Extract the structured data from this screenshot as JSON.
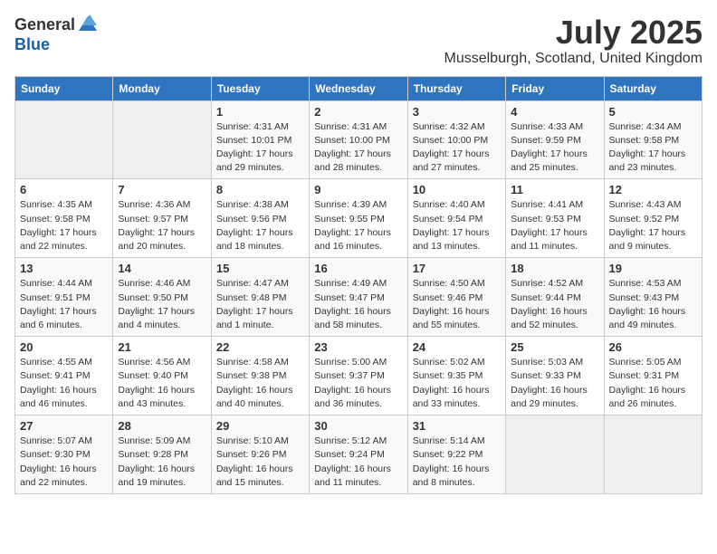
{
  "header": {
    "logo_general": "General",
    "logo_blue": "Blue",
    "month_title": "July 2025",
    "location": "Musselburgh, Scotland, United Kingdom"
  },
  "days_of_week": [
    "Sunday",
    "Monday",
    "Tuesday",
    "Wednesday",
    "Thursday",
    "Friday",
    "Saturday"
  ],
  "weeks": [
    [
      {
        "day": "",
        "info": ""
      },
      {
        "day": "",
        "info": ""
      },
      {
        "day": "1",
        "info": "Sunrise: 4:31 AM\nSunset: 10:01 PM\nDaylight: 17 hours and 29 minutes."
      },
      {
        "day": "2",
        "info": "Sunrise: 4:31 AM\nSunset: 10:00 PM\nDaylight: 17 hours and 28 minutes."
      },
      {
        "day": "3",
        "info": "Sunrise: 4:32 AM\nSunset: 10:00 PM\nDaylight: 17 hours and 27 minutes."
      },
      {
        "day": "4",
        "info": "Sunrise: 4:33 AM\nSunset: 9:59 PM\nDaylight: 17 hours and 25 minutes."
      },
      {
        "day": "5",
        "info": "Sunrise: 4:34 AM\nSunset: 9:58 PM\nDaylight: 17 hours and 23 minutes."
      }
    ],
    [
      {
        "day": "6",
        "info": "Sunrise: 4:35 AM\nSunset: 9:58 PM\nDaylight: 17 hours and 22 minutes."
      },
      {
        "day": "7",
        "info": "Sunrise: 4:36 AM\nSunset: 9:57 PM\nDaylight: 17 hours and 20 minutes."
      },
      {
        "day": "8",
        "info": "Sunrise: 4:38 AM\nSunset: 9:56 PM\nDaylight: 17 hours and 18 minutes."
      },
      {
        "day": "9",
        "info": "Sunrise: 4:39 AM\nSunset: 9:55 PM\nDaylight: 17 hours and 16 minutes."
      },
      {
        "day": "10",
        "info": "Sunrise: 4:40 AM\nSunset: 9:54 PM\nDaylight: 17 hours and 13 minutes."
      },
      {
        "day": "11",
        "info": "Sunrise: 4:41 AM\nSunset: 9:53 PM\nDaylight: 17 hours and 11 minutes."
      },
      {
        "day": "12",
        "info": "Sunrise: 4:43 AM\nSunset: 9:52 PM\nDaylight: 17 hours and 9 minutes."
      }
    ],
    [
      {
        "day": "13",
        "info": "Sunrise: 4:44 AM\nSunset: 9:51 PM\nDaylight: 17 hours and 6 minutes."
      },
      {
        "day": "14",
        "info": "Sunrise: 4:46 AM\nSunset: 9:50 PM\nDaylight: 17 hours and 4 minutes."
      },
      {
        "day": "15",
        "info": "Sunrise: 4:47 AM\nSunset: 9:48 PM\nDaylight: 17 hours and 1 minute."
      },
      {
        "day": "16",
        "info": "Sunrise: 4:49 AM\nSunset: 9:47 PM\nDaylight: 16 hours and 58 minutes."
      },
      {
        "day": "17",
        "info": "Sunrise: 4:50 AM\nSunset: 9:46 PM\nDaylight: 16 hours and 55 minutes."
      },
      {
        "day": "18",
        "info": "Sunrise: 4:52 AM\nSunset: 9:44 PM\nDaylight: 16 hours and 52 minutes."
      },
      {
        "day": "19",
        "info": "Sunrise: 4:53 AM\nSunset: 9:43 PM\nDaylight: 16 hours and 49 minutes."
      }
    ],
    [
      {
        "day": "20",
        "info": "Sunrise: 4:55 AM\nSunset: 9:41 PM\nDaylight: 16 hours and 46 minutes."
      },
      {
        "day": "21",
        "info": "Sunrise: 4:56 AM\nSunset: 9:40 PM\nDaylight: 16 hours and 43 minutes."
      },
      {
        "day": "22",
        "info": "Sunrise: 4:58 AM\nSunset: 9:38 PM\nDaylight: 16 hours and 40 minutes."
      },
      {
        "day": "23",
        "info": "Sunrise: 5:00 AM\nSunset: 9:37 PM\nDaylight: 16 hours and 36 minutes."
      },
      {
        "day": "24",
        "info": "Sunrise: 5:02 AM\nSunset: 9:35 PM\nDaylight: 16 hours and 33 minutes."
      },
      {
        "day": "25",
        "info": "Sunrise: 5:03 AM\nSunset: 9:33 PM\nDaylight: 16 hours and 29 minutes."
      },
      {
        "day": "26",
        "info": "Sunrise: 5:05 AM\nSunset: 9:31 PM\nDaylight: 16 hours and 26 minutes."
      }
    ],
    [
      {
        "day": "27",
        "info": "Sunrise: 5:07 AM\nSunset: 9:30 PM\nDaylight: 16 hours and 22 minutes."
      },
      {
        "day": "28",
        "info": "Sunrise: 5:09 AM\nSunset: 9:28 PM\nDaylight: 16 hours and 19 minutes."
      },
      {
        "day": "29",
        "info": "Sunrise: 5:10 AM\nSunset: 9:26 PM\nDaylight: 16 hours and 15 minutes."
      },
      {
        "day": "30",
        "info": "Sunrise: 5:12 AM\nSunset: 9:24 PM\nDaylight: 16 hours and 11 minutes."
      },
      {
        "day": "31",
        "info": "Sunrise: 5:14 AM\nSunset: 9:22 PM\nDaylight: 16 hours and 8 minutes."
      },
      {
        "day": "",
        "info": ""
      },
      {
        "day": "",
        "info": ""
      }
    ]
  ]
}
